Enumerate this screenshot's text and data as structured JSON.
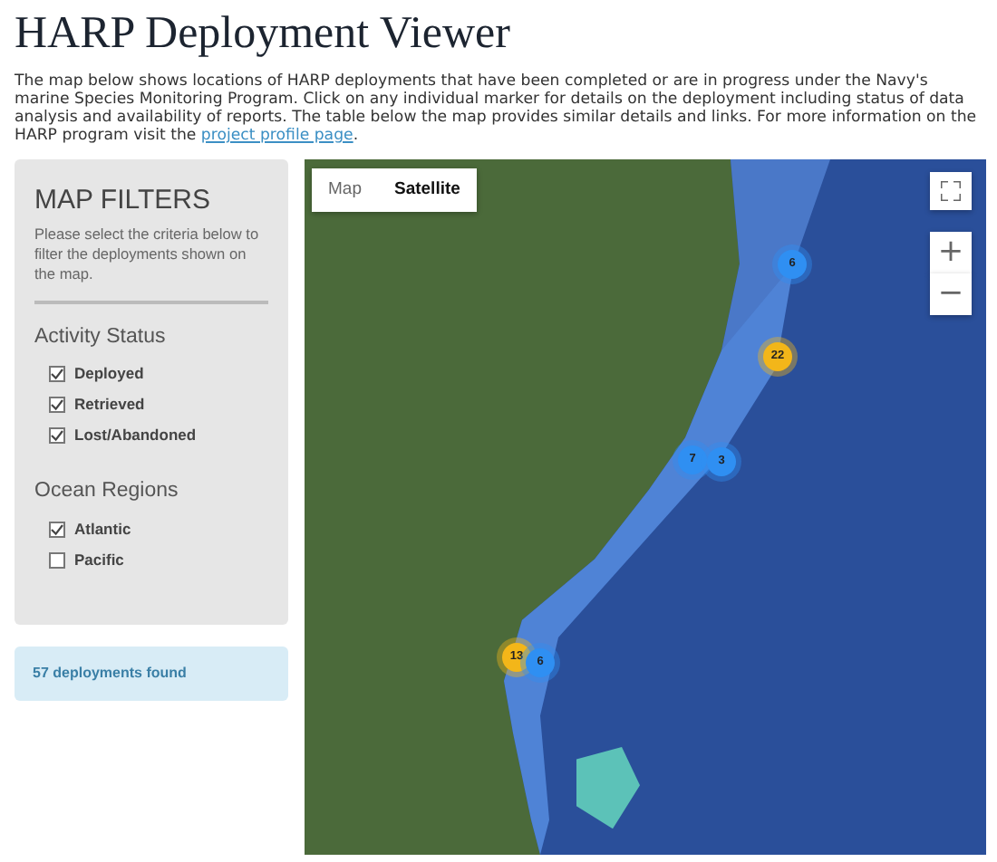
{
  "page": {
    "title": "HARP Deployment Viewer",
    "intro": "The map below shows locations of HARP deployments that have been completed or are in progress under the Navy's marine Species Monitoring Program.  Click on any individual marker for details on the deployment including status of data analysis and availability of reports.  The table below the map provides similar details and links. For more information on the HARP program visit the ",
    "intro_link": "project profile page",
    "intro_end": "."
  },
  "filters": {
    "title": "MAP FILTERS",
    "hint": "Please select the criteria below to filter the deployments shown on the map.",
    "groups": [
      {
        "title": "Activity Status",
        "options": [
          {
            "label": "Deployed",
            "checked": true
          },
          {
            "label": "Retrieved",
            "checked": true
          },
          {
            "label": "Lost/Abandoned",
            "checked": true
          }
        ]
      },
      {
        "title": "Ocean Regions",
        "options": [
          {
            "label": "Atlantic",
            "checked": true
          },
          {
            "label": "Pacific",
            "checked": false
          }
        ]
      }
    ]
  },
  "result": "57 deployments found",
  "map": {
    "types": [
      {
        "label": "Map",
        "selected": false
      },
      {
        "label": "Satellite",
        "selected": true
      }
    ],
    "zoom_in": "+",
    "zoom_out": "−",
    "clusters": [
      {
        "count": "6",
        "color": "#2f8ff2"
      },
      {
        "count": "22",
        "color": "#f3b619"
      },
      {
        "count": "7",
        "color": "#2f8ff2"
      },
      {
        "count": "3",
        "color": "#2f8ff2"
      },
      {
        "count": "13",
        "color": "#f3b619"
      },
      {
        "count": "6",
        "color": "#2f8ff2"
      }
    ]
  }
}
